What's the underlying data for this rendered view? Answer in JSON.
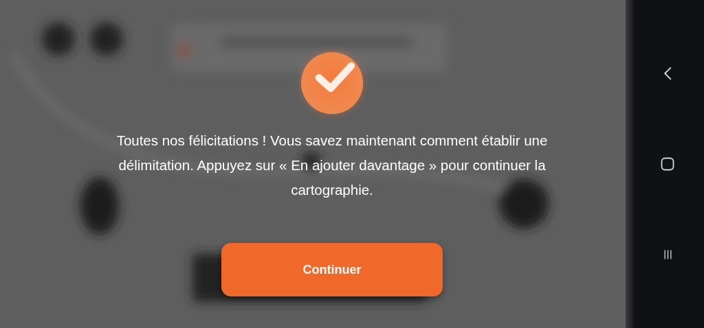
{
  "dialog": {
    "message": "Toutes nos félicitations ! Vous savez maintenant comment établir une délimitation. Appuyez sur « En ajouter davantage » pour continuer la cartographie.",
    "button": {
      "label": "Continuer"
    }
  }
}
